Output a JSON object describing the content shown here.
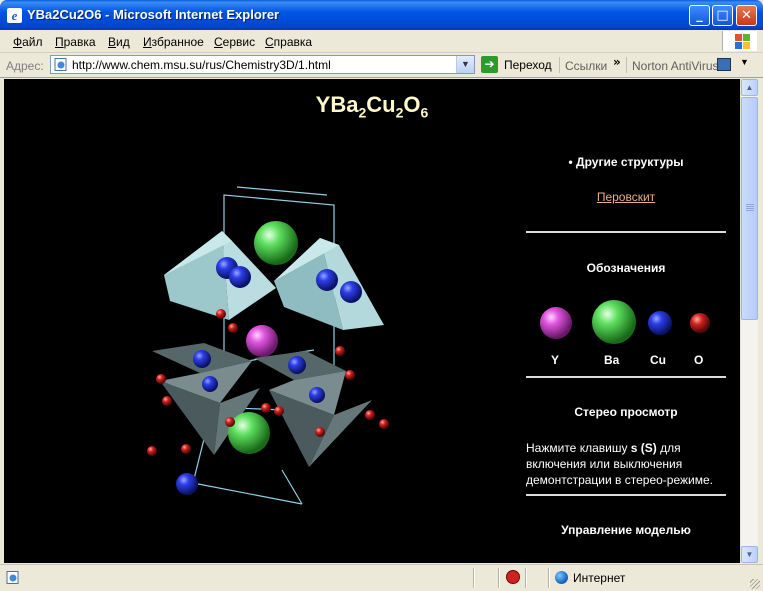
{
  "window": {
    "title": "YBa2Cu2O6 - Microsoft Internet Explorer"
  },
  "menu": {
    "items": [
      {
        "first": "Ф",
        "rest": "айл"
      },
      {
        "first": "П",
        "rest": "равка"
      },
      {
        "first": "В",
        "rest": "ид"
      },
      {
        "first": "И",
        "rest": "збранное"
      },
      {
        "first": "С",
        "rest": "ервис"
      },
      {
        "first": "С",
        "rest": "правка"
      }
    ]
  },
  "address": {
    "label": "Адрес:",
    "url": "http://www.chem.msu.su/rus/Chemistry3D/1.html",
    "go_label": "Переход",
    "links_label": "Ссылки",
    "norton_label": "Norton AntiVirus"
  },
  "page": {
    "title_parts": {
      "a": "YBa",
      "s1": "2",
      "b": "Cu",
      "s2": "2",
      "c": "O",
      "s3": "6"
    },
    "bullet": "Другие структуры",
    "link": "Перовскит",
    "legend_title": "Обозначения",
    "legend": [
      {
        "label": "Y",
        "color": "#e050e0"
      },
      {
        "label": "Ba",
        "color": "#50e050"
      },
      {
        "label": "Cu",
        "color": "#2a3ce8"
      },
      {
        "label": "O",
        "color": "#d42020"
      }
    ],
    "stereo_title": "Стерео просмотр",
    "stereo_text_pre": "Нажмите клавишу ",
    "stereo_key": "s (S)",
    "stereo_text_post": " для включения или выключения демонтстрации в стерео-режиме.",
    "control_title": "Управление моделью"
  },
  "status": {
    "zone": "Интернет"
  },
  "colors": {
    "pyramid_light": "#a9cfd2",
    "pyramid_dark": "#5a6b6e",
    "bond": "#8fd0e8"
  }
}
